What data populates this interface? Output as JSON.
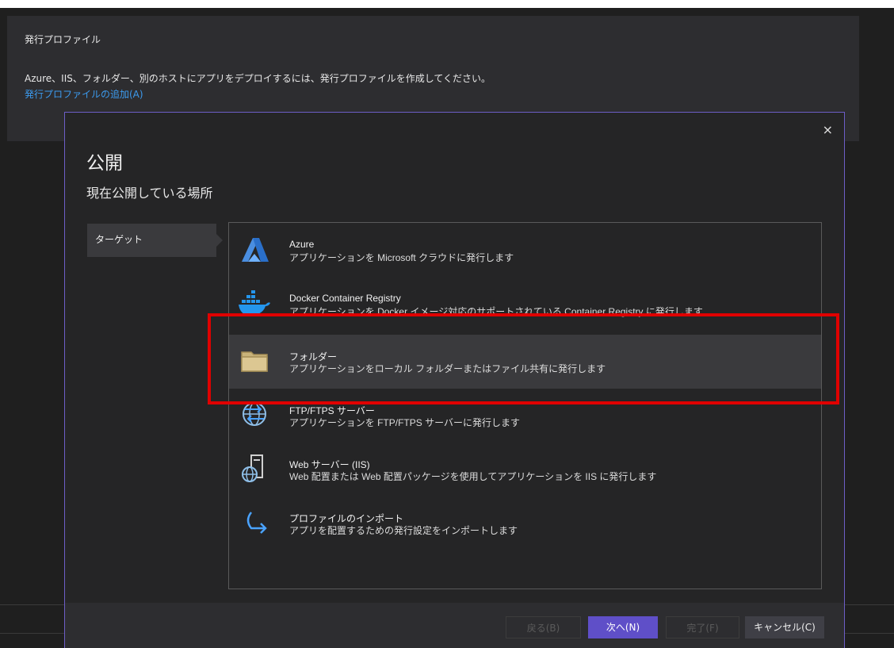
{
  "publish_panel": {
    "title": "発行プロファイル",
    "description": "Azure、IIS、フォルダー、別のホストにアプリをデプロイするには、発行プロファイルを作成してください。",
    "add_link": "発行プロファイルの追加(A)"
  },
  "dialog": {
    "title": "公開",
    "subtitle": "現在公開している場所",
    "close_glyph": "×",
    "nav": {
      "target_label": "ターゲット"
    },
    "targets": [
      {
        "name": "Azure",
        "description": "アプリケーションを Microsoft クラウドに発行します",
        "icon": "azure-icon"
      },
      {
        "name": "Docker Container Registry",
        "description": "アプリケーションを Docker イメージ対応のサポートされている Container Registry に発行します",
        "icon": "docker-icon"
      },
      {
        "name": "フォルダー",
        "description": "アプリケーションをローカル フォルダーまたはファイル共有に発行します",
        "icon": "folder-icon"
      },
      {
        "name": "FTP/FTPS サーバー",
        "description": "アプリケーションを FTP/FTPS サーバーに発行します",
        "icon": "ftp-globe-icon"
      },
      {
        "name": "Web サーバー (IIS)",
        "description": "Web 配置または Web 配置パッケージを使用してアプリケーションを IIS に発行します",
        "icon": "web-server-icon"
      },
      {
        "name": "プロファイルのインポート",
        "description": "アプリを配置するための発行設定をインポートします",
        "icon": "import-arrow-icon"
      }
    ],
    "selected_index": 2,
    "buttons": {
      "back": "戻る(B)",
      "next": "次へ(N)",
      "finish": "完了(F)",
      "cancel": "キャンセル(C)"
    }
  },
  "colors": {
    "accent": "#5f4fc8",
    "highlight_box": "#e00000",
    "link": "#3c9bef"
  }
}
